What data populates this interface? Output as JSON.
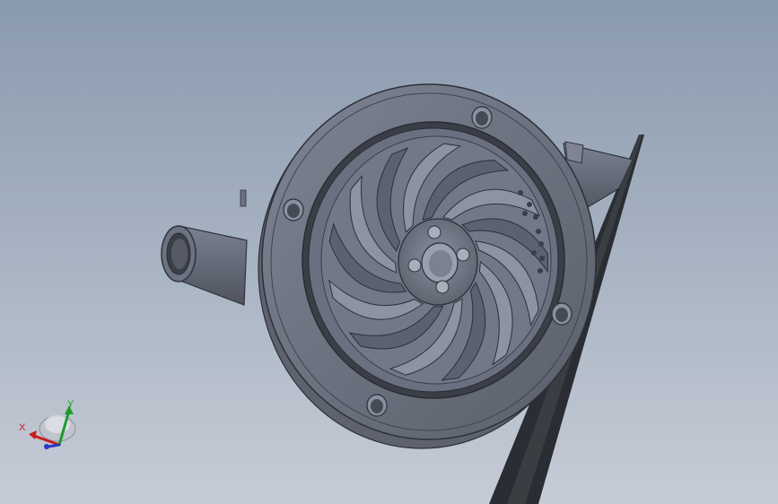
{
  "viewport": {
    "background_top": "#8a9aae",
    "background_bottom": "#c6ccd6",
    "model_color": "#6f7583",
    "model_dark": "#3c414c"
  },
  "triad": {
    "x_label": "X",
    "y_label": "Y",
    "x_color": "#c81e1e",
    "y_color": "#1e9a2a",
    "z_color": "#2a3ac0"
  }
}
